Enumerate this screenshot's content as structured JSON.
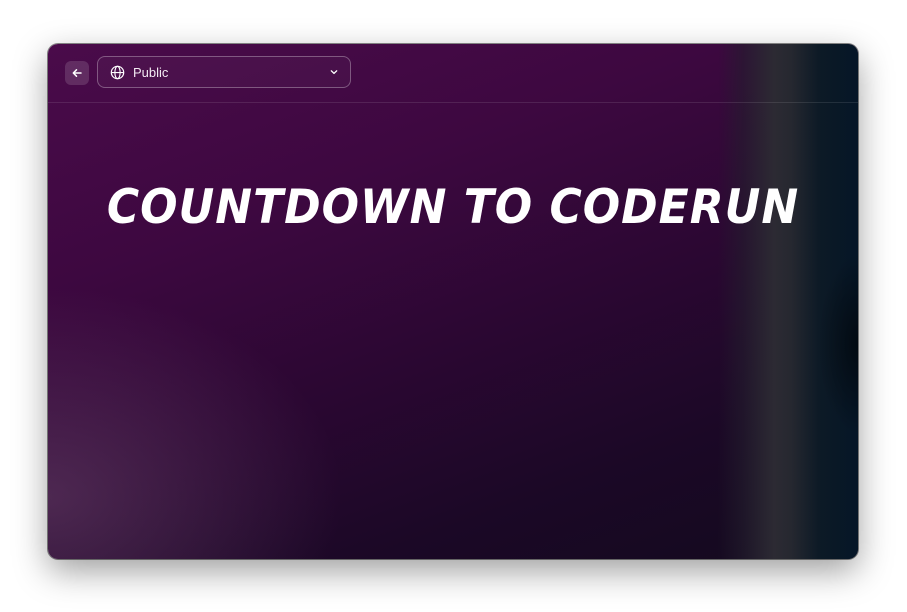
{
  "toolbar": {
    "back_icon": "arrow-left-icon",
    "visibility": {
      "icon": "globe-icon",
      "selected": "Public",
      "chevron_icon": "chevron-down-icon"
    }
  },
  "main": {
    "title": "COUNTDOWN TO CODERUN"
  },
  "colors": {
    "background_top": "#4a0b4a",
    "background_bottom": "#130a1e",
    "right_band": "#051627",
    "title_text": "#ffffff"
  }
}
